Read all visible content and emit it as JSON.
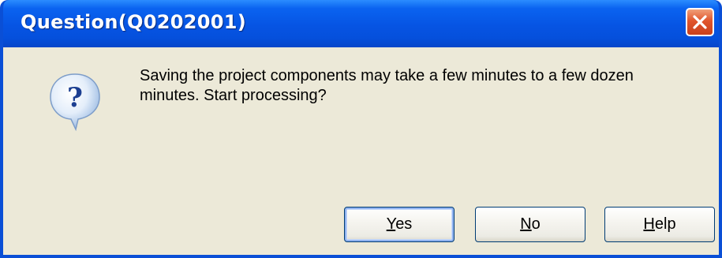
{
  "dialog": {
    "title": "Question(Q0202001)",
    "icon": "question-icon",
    "message": "Saving the project components may take a few minutes to a few dozen minutes. Start processing?",
    "close_icon": "close-icon"
  },
  "buttons": {
    "yes": {
      "mnemonic": "Y",
      "rest": "es"
    },
    "no": {
      "mnemonic": "N",
      "rest": "o"
    },
    "help": {
      "mnemonic": "H",
      "rest": "elp"
    }
  },
  "colors": {
    "titlebar": "#0654e3",
    "client_bg": "#ece9d8",
    "close_button": "#e0552c"
  }
}
